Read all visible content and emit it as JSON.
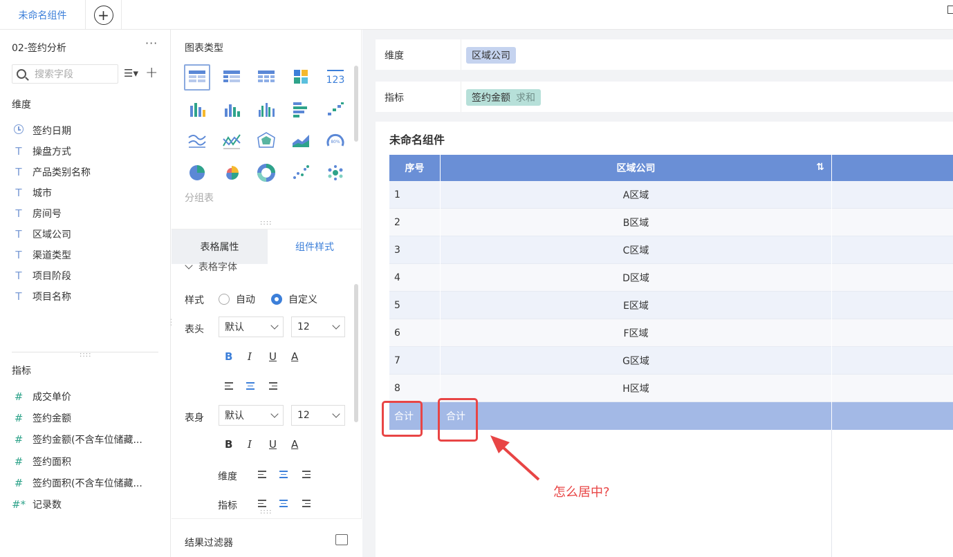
{
  "topbar": {
    "active_tab": "未命名组件",
    "add_icon": "plus-circle-icon"
  },
  "left": {
    "dataset_title": "02-签约分析",
    "more": "···",
    "search_placeholder": "搜索字段",
    "dim_section": "维度",
    "dimensions": [
      {
        "label": "签约日期",
        "type": "date"
      },
      {
        "label": "操盘方式",
        "type": "text"
      },
      {
        "label": "产品类别名称",
        "type": "text"
      },
      {
        "label": "城市",
        "type": "text"
      },
      {
        "label": "房间号",
        "type": "text"
      },
      {
        "label": "区域公司",
        "type": "text"
      },
      {
        "label": "渠道类型",
        "type": "text"
      },
      {
        "label": "项目阶段",
        "type": "text"
      },
      {
        "label": "项目名称",
        "type": "text"
      }
    ],
    "metric_section": "指标",
    "metrics": [
      {
        "label": "成交单价",
        "icon": "#"
      },
      {
        "label": "签约金额",
        "icon": "#"
      },
      {
        "label": "签约金额(不含车位储藏...",
        "icon": "#"
      },
      {
        "label": "签约面积",
        "icon": "#"
      },
      {
        "label": "签约面积(不含车位储藏...",
        "icon": "#"
      },
      {
        "label": "记录数",
        "icon": "#*"
      }
    ]
  },
  "middle": {
    "chart_type_title": "图表类型",
    "group_label": "分组表",
    "tab_table_props": "表格属性",
    "tab_component_style": "组件样式",
    "font_section": "表格字体",
    "style_label": "样式",
    "style_auto": "自动",
    "style_custom": "自定义",
    "header_label": "表头",
    "header_font": "默认",
    "header_size": "12",
    "body_label": "表身",
    "body_font": "默认",
    "body_size": "12",
    "dim_label": "维度",
    "metric_label": "指标",
    "format_bold": "B",
    "format_italic": "I",
    "format_underline": "U",
    "format_color": "A",
    "filter_label": "结果过滤器"
  },
  "right": {
    "dim_bar_label": "维度",
    "dim_pill": "区域公司",
    "metric_bar_label": "指标",
    "metric_pill": "签约金额",
    "metric_agg": "求和",
    "card_title": "未命名组件",
    "table": {
      "headers": [
        "序号",
        "区域公司"
      ],
      "rows": [
        [
          "1",
          "A区域"
        ],
        [
          "2",
          "B区域"
        ],
        [
          "3",
          "C区域"
        ],
        [
          "4",
          "D区域"
        ],
        [
          "5",
          "E区域"
        ],
        [
          "6",
          "F区域"
        ],
        [
          "7",
          "G区域"
        ],
        [
          "8",
          "H区域"
        ]
      ],
      "total_label_1": "合计",
      "total_label_2": "合计"
    },
    "annotation": "怎么居中?"
  },
  "colors": {
    "accent": "#3c7fd9",
    "header_bg": "#6a8fd6",
    "total_bg": "#a3b9e6",
    "highlight": "#e84545"
  }
}
